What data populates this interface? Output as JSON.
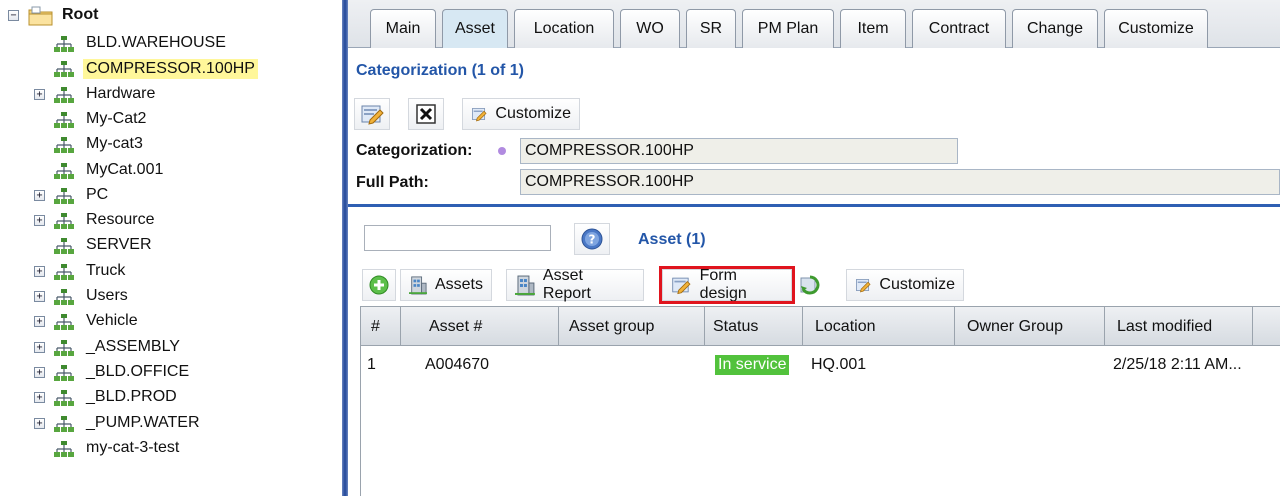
{
  "tree": {
    "root_label": "Root",
    "items": [
      {
        "label": "BLD.WAREHOUSE",
        "expander": false,
        "selected": false
      },
      {
        "label": "COMPRESSOR.100HP",
        "expander": false,
        "selected": true
      },
      {
        "label": "Hardware",
        "expander": true,
        "selected": false
      },
      {
        "label": "My-Cat2",
        "expander": false,
        "selected": false
      },
      {
        "label": "My-cat3",
        "expander": false,
        "selected": false
      },
      {
        "label": "MyCat.001",
        "expander": false,
        "selected": false
      },
      {
        "label": "PC",
        "expander": true,
        "selected": false
      },
      {
        "label": "Resource",
        "expander": true,
        "selected": false
      },
      {
        "label": "SERVER",
        "expander": false,
        "selected": false
      },
      {
        "label": "Truck",
        "expander": true,
        "selected": false
      },
      {
        "label": "Users",
        "expander": true,
        "selected": false
      },
      {
        "label": "Vehicle",
        "expander": true,
        "selected": false
      },
      {
        "label": "_ASSEMBLY",
        "expander": true,
        "selected": false
      },
      {
        "label": "_BLD.OFFICE",
        "expander": true,
        "selected": false
      },
      {
        "label": "_BLD.PROD",
        "expander": true,
        "selected": false
      },
      {
        "label": "_PUMP.WATER",
        "expander": true,
        "selected": false
      },
      {
        "label": "my-cat-3-test",
        "expander": false,
        "selected": false
      }
    ]
  },
  "tabs": [
    "Main",
    "Asset",
    "Location",
    "WO",
    "SR",
    "PM Plan",
    "Item",
    "Contract",
    "Change",
    "Customize"
  ],
  "active_tab": "Asset",
  "categorization": {
    "title": "Categorization (1 of 1)",
    "customize_label": "Customize",
    "categorization_label": "Categorization:",
    "categorization_value": "COMPRESSOR.100HP",
    "full_path_label": "Full Path:",
    "full_path_value": "COMPRESSOR.100HP"
  },
  "asset_section": {
    "title": "Asset (1)",
    "search_value": "",
    "toolbar": {
      "assets_label": "Assets",
      "asset_report_label": "Asset Report",
      "form_design_label": "Form design",
      "customize_label": "Customize"
    },
    "columns": [
      "#",
      "Asset #",
      "Asset group",
      "Status",
      "Location",
      "Owner Group",
      "Last modified"
    ],
    "rows": [
      {
        "num": "1",
        "asset_no": "A004670",
        "asset_group": "",
        "status": "In service",
        "location": "HQ.001",
        "owner_group": "",
        "last_modified": "2/25/18 2:11 AM..."
      }
    ]
  },
  "colors": {
    "accent_blue": "#2356a8",
    "status_green": "#52c23c",
    "selected_highlight": "#fff79a",
    "form_design_outline": "#e0141e"
  }
}
